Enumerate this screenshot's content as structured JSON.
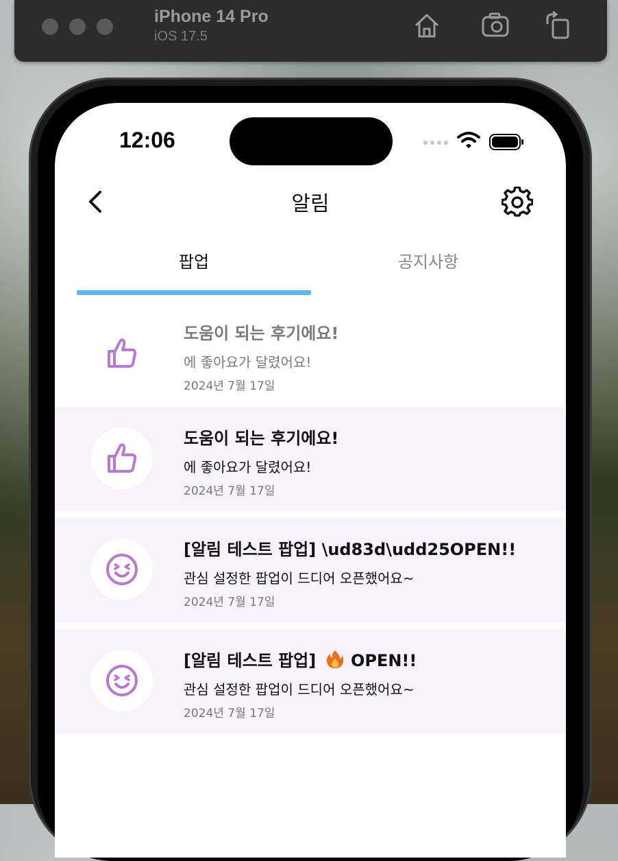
{
  "simulator": {
    "device_name": "iPhone 14 Pro",
    "os_version": "iOS 17.5",
    "icons": [
      "home-icon",
      "screenshot-icon",
      "rotate-icon"
    ]
  },
  "status_bar": {
    "time": "12:06"
  },
  "nav": {
    "title": "알림"
  },
  "tabs": [
    {
      "label": "팝업",
      "active": true
    },
    {
      "label": "공지사항",
      "active": false
    }
  ],
  "accent_color": "#5db6ee",
  "icon_color": "#b978d6",
  "notifications": [
    {
      "icon": "thumbs-up-icon",
      "title": "도움이 되는 후기에요!",
      "body": "에 좋아요가 달렸어요!",
      "date": "2024년 7월 17일",
      "read": true
    },
    {
      "icon": "thumbs-up-icon",
      "title": "도움이 되는 후기에요!",
      "body": "에 좋아요가 달렸어요!",
      "date": "2024년 7월 17일",
      "read": false
    },
    {
      "icon": "smile-icon",
      "title": "[알림 테스트 팝업] \\ud83d\\udd25OPEN!!",
      "body": "관심 설정한 팝업이 드디어 오픈했어요~",
      "date": "2024년 7월 17일",
      "read": false
    },
    {
      "icon": "smile-icon",
      "title_prefix": "[알림 테스트 팝업]",
      "title_suffix": "OPEN!!",
      "title_emoji": "fire-emoji",
      "body": "관심 설정한 팝업이 드디어 오픈했어요~",
      "date": "2024년 7월 17일",
      "read": false
    }
  ]
}
